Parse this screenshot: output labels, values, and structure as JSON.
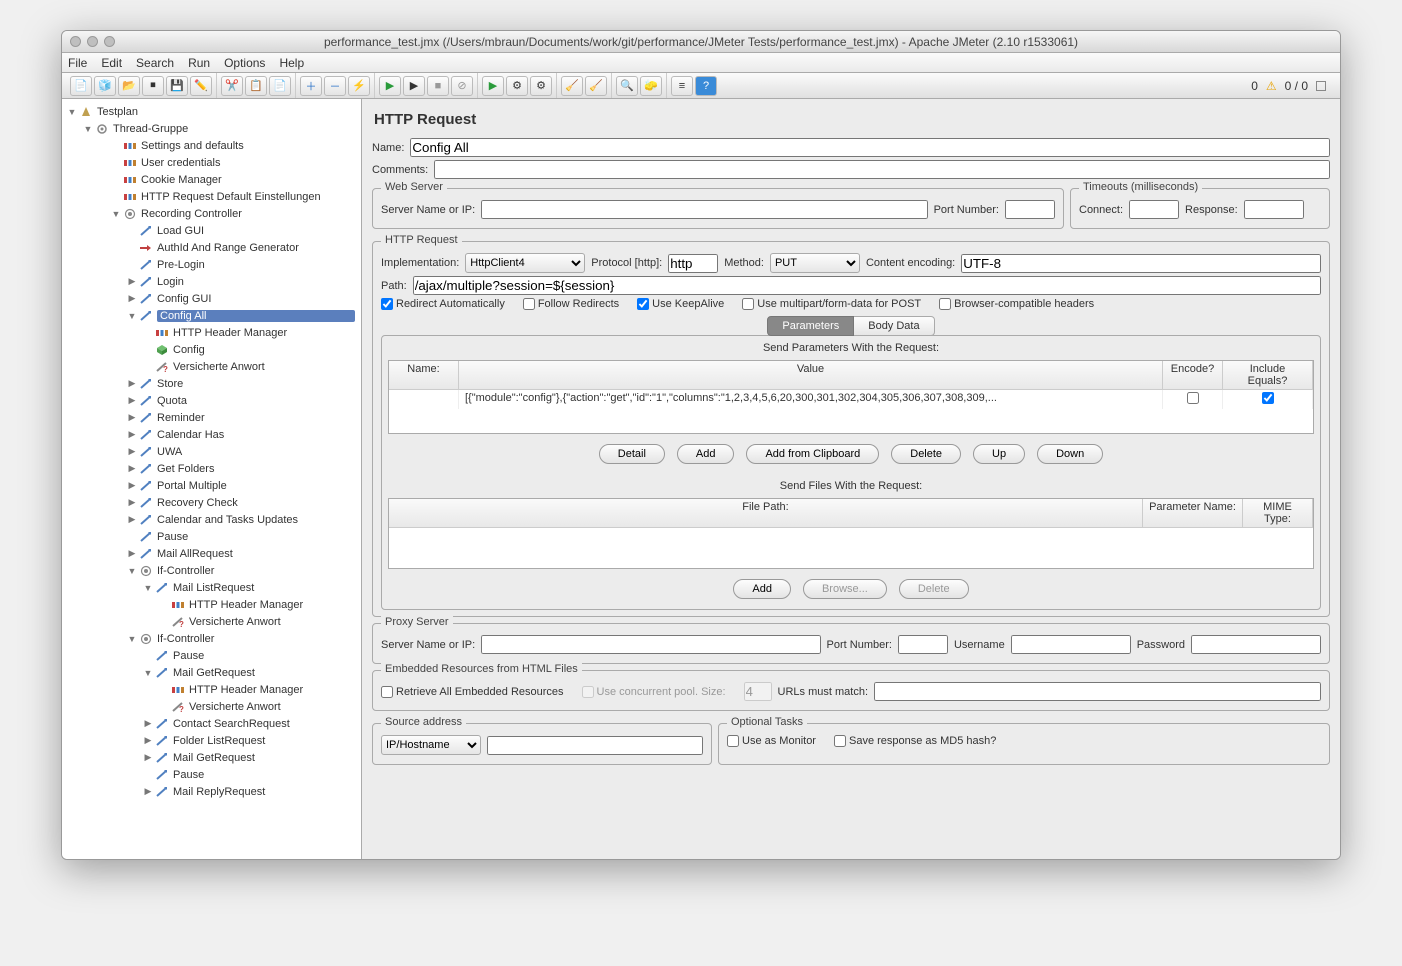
{
  "window_title": "performance_test.jmx (/Users/mbraun/Documents/work/git/performance/JMeter Tests/performance_test.jmx) - Apache JMeter (2.10 r1533061)",
  "menu": [
    "File",
    "Edit",
    "Search",
    "Run",
    "Options",
    "Help"
  ],
  "status": {
    "warn": "0",
    "counter": "0 / 0"
  },
  "tree": [
    {
      "d": 0,
      "tw": "▼",
      "ic": "testplan",
      "lbl": "Testplan"
    },
    {
      "d": 1,
      "tw": "▼",
      "ic": "thread",
      "lbl": "Thread-Gruppe"
    },
    {
      "d": 2,
      "tw": "",
      "ic": "gear",
      "lbl": "Settings and defaults"
    },
    {
      "d": 2,
      "tw": "",
      "ic": "gear",
      "lbl": "User credentials"
    },
    {
      "d": 2,
      "tw": "",
      "ic": "gear",
      "lbl": "Cookie Manager"
    },
    {
      "d": 2,
      "tw": "",
      "ic": "gear",
      "lbl": "HTTP Request Default Einstellungen"
    },
    {
      "d": 2,
      "tw": "▼",
      "ic": "rec",
      "lbl": "Recording Controller"
    },
    {
      "d": 3,
      "tw": "",
      "ic": "req",
      "lbl": "Load GUI"
    },
    {
      "d": 3,
      "tw": "",
      "ic": "arrow",
      "lbl": "AuthId And Range Generator"
    },
    {
      "d": 3,
      "tw": "",
      "ic": "req",
      "lbl": "Pre-Login"
    },
    {
      "d": 3,
      "tw": "▶",
      "ic": "req",
      "lbl": "Login"
    },
    {
      "d": 3,
      "tw": "▶",
      "ic": "req",
      "lbl": "Config GUI"
    },
    {
      "d": 3,
      "tw": "▼",
      "ic": "req",
      "lbl": "Config All",
      "sel": 1
    },
    {
      "d": 4,
      "tw": "",
      "ic": "gear",
      "lbl": "HTTP Header Manager"
    },
    {
      "d": 4,
      "tw": "",
      "ic": "cube",
      "lbl": "Config"
    },
    {
      "d": 4,
      "tw": "",
      "ic": "assert",
      "lbl": "Versicherte Anwort"
    },
    {
      "d": 3,
      "tw": "▶",
      "ic": "req",
      "lbl": "Store"
    },
    {
      "d": 3,
      "tw": "▶",
      "ic": "req",
      "lbl": "Quota"
    },
    {
      "d": 3,
      "tw": "▶",
      "ic": "req",
      "lbl": "Reminder"
    },
    {
      "d": 3,
      "tw": "▶",
      "ic": "req",
      "lbl": "Calendar Has"
    },
    {
      "d": 3,
      "tw": "▶",
      "ic": "req",
      "lbl": "UWA"
    },
    {
      "d": 3,
      "tw": "▶",
      "ic": "req",
      "lbl": "Get Folders"
    },
    {
      "d": 3,
      "tw": "▶",
      "ic": "req",
      "lbl": "Portal Multiple"
    },
    {
      "d": 3,
      "tw": "▶",
      "ic": "req",
      "lbl": "Recovery Check"
    },
    {
      "d": 3,
      "tw": "▶",
      "ic": "req",
      "lbl": "Calendar and Tasks Updates"
    },
    {
      "d": 3,
      "tw": "",
      "ic": "req",
      "lbl": "Pause"
    },
    {
      "d": 3,
      "tw": "▶",
      "ic": "req",
      "lbl": "Mail AllRequest"
    },
    {
      "d": 3,
      "tw": "▼",
      "ic": "rec",
      "lbl": "If-Controller"
    },
    {
      "d": 4,
      "tw": "▼",
      "ic": "req",
      "lbl": "Mail ListRequest"
    },
    {
      "d": 5,
      "tw": "",
      "ic": "gear",
      "lbl": "HTTP Header Manager"
    },
    {
      "d": 5,
      "tw": "",
      "ic": "assert",
      "lbl": "Versicherte Anwort"
    },
    {
      "d": 3,
      "tw": "▼",
      "ic": "rec",
      "lbl": "If-Controller"
    },
    {
      "d": 4,
      "tw": "",
      "ic": "req",
      "lbl": "Pause"
    },
    {
      "d": 4,
      "tw": "▼",
      "ic": "req",
      "lbl": "Mail GetRequest"
    },
    {
      "d": 5,
      "tw": "",
      "ic": "gear",
      "lbl": "HTTP Header Manager"
    },
    {
      "d": 5,
      "tw": "",
      "ic": "assert",
      "lbl": "Versicherte Anwort"
    },
    {
      "d": 4,
      "tw": "▶",
      "ic": "req",
      "lbl": "Contact SearchRequest"
    },
    {
      "d": 4,
      "tw": "▶",
      "ic": "req",
      "lbl": "Folder ListRequest"
    },
    {
      "d": 4,
      "tw": "▶",
      "ic": "req",
      "lbl": "Mail GetRequest"
    },
    {
      "d": 4,
      "tw": "",
      "ic": "req",
      "lbl": "Pause"
    },
    {
      "d": 4,
      "tw": "▶",
      "ic": "req",
      "lbl": "Mail ReplyRequest"
    }
  ],
  "panel": {
    "title": "HTTP Request",
    "name_label": "Name:",
    "name_value": "Config All",
    "comments_label": "Comments:",
    "comments_value": "",
    "web_server": {
      "legend": "Web Server",
      "server_label": "Server Name or IP:",
      "server_value": "",
      "port_label": "Port Number:",
      "port_value": ""
    },
    "timeouts": {
      "legend": "Timeouts (milliseconds)",
      "connect_label": "Connect:",
      "connect_value": "",
      "response_label": "Response:",
      "response_value": ""
    },
    "http": {
      "legend": "HTTP Request",
      "impl_label": "Implementation:",
      "impl_value": "HttpClient4",
      "proto_label": "Protocol [http]:",
      "proto_value": "http",
      "method_label": "Method:",
      "method_value": "PUT",
      "enc_label": "Content encoding:",
      "enc_value": "UTF-8",
      "path_label": "Path:",
      "path_value": "/ajax/multiple?session=${session}",
      "redirect_auto": "Redirect Automatically",
      "follow_redirects": "Follow Redirects",
      "keepalive": "Use KeepAlive",
      "multipart": "Use multipart/form-data for POST",
      "browser_headers": "Browser-compatible headers"
    },
    "tabs": {
      "params": "Parameters",
      "body": "Body Data"
    },
    "params": {
      "title": "Send Parameters With the Request:",
      "cols": [
        "Name:",
        "Value",
        "Encode?",
        "Include Equals?"
      ],
      "rows": [
        {
          "name": "",
          "value": "[{\"module\":\"config\"},{\"action\":\"get\",\"id\":\"1\",\"columns\":\"1,2,3,4,5,6,20,300,301,302,304,305,306,307,308,309,...",
          "encode": false,
          "include": true
        }
      ],
      "buttons": [
        "Detail",
        "Add",
        "Add from Clipboard",
        "Delete",
        "Up",
        "Down"
      ]
    },
    "files": {
      "title": "Send Files With the Request:",
      "cols": [
        "File Path:",
        "Parameter Name:",
        "MIME Type:"
      ],
      "buttons": [
        "Add",
        "Browse...",
        "Delete"
      ]
    },
    "proxy": {
      "legend": "Proxy Server",
      "server_label": "Server Name or IP:",
      "port_label": "Port Number:",
      "user_label": "Username",
      "pass_label": "Password"
    },
    "embedded": {
      "legend": "Embedded Resources from HTML Files",
      "retrieve": "Retrieve All Embedded Resources",
      "concurrent": "Use concurrent pool. Size:",
      "pool_size": "4",
      "urls_match": "URLs must match:"
    },
    "source": {
      "legend": "Source address",
      "type": "IP/Hostname"
    },
    "optional": {
      "legend": "Optional Tasks",
      "monitor": "Use as Monitor",
      "md5": "Save response as MD5 hash?"
    }
  }
}
